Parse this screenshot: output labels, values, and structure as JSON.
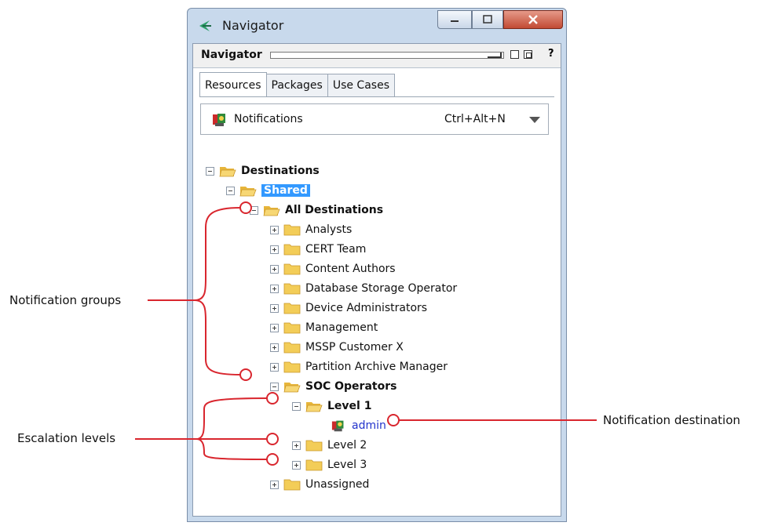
{
  "window": {
    "title": "Navigator"
  },
  "navigator_bar": {
    "label": "Navigator",
    "help": "?"
  },
  "tabs": [
    {
      "label": "Resources",
      "active": true
    },
    {
      "label": "Packages",
      "active": false
    },
    {
      "label": "Use Cases",
      "active": false
    }
  ],
  "combo": {
    "value": "Notifications",
    "shortcut": "Ctrl+Alt+N"
  },
  "tree": {
    "destinations": "Destinations",
    "shared": "Shared",
    "all_destinations": "All Destinations",
    "groups": [
      "Analysts",
      "CERT Team",
      "Content Authors",
      "Database Storage Operator",
      "Device Administrators",
      "Management",
      "MSSP Customer X",
      "Partition Archive Manager"
    ],
    "soc_operators": "SOC Operators",
    "level1": "Level 1",
    "admin": "admin",
    "level2": "Level 2",
    "level3": "Level 3",
    "unassigned": "Unassigned"
  },
  "annotations": {
    "notification_groups": "Notification groups",
    "escalation_levels": "Escalation levels",
    "notification_destination": "Notification destination"
  },
  "colors": {
    "callout": "#d9262e",
    "selection": "#3399ff",
    "folder": "#f2c94c"
  }
}
